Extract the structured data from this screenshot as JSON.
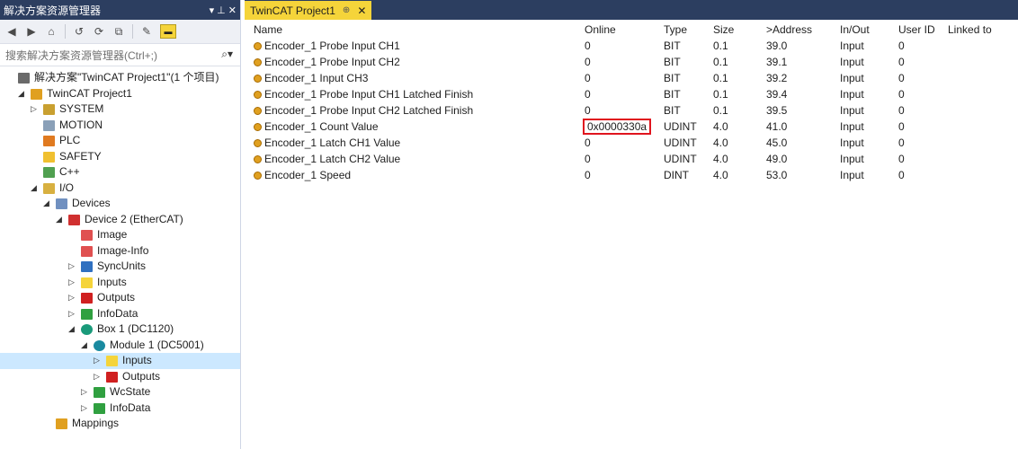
{
  "left_pane": {
    "title": "解决方案资源管理器",
    "pin": "▾ ⊥ ✕",
    "search_placeholder": "搜索解决方案资源管理器(Ctrl+;)",
    "tree": [
      {
        "label": "解决方案\"TwinCAT Project1\"(1 个项目)",
        "level": 0,
        "icon": "solution-icon",
        "toggle": ""
      },
      {
        "label": "TwinCAT Project1",
        "level": 1,
        "icon": "project-icon",
        "toggle": "◢"
      },
      {
        "label": "SYSTEM",
        "level": 2,
        "icon": "system-icon",
        "toggle": "▷"
      },
      {
        "label": "MOTION",
        "level": 2,
        "icon": "motion-icon",
        "toggle": ""
      },
      {
        "label": "PLC",
        "level": 2,
        "icon": "plc-icon",
        "toggle": ""
      },
      {
        "label": "SAFETY",
        "level": 2,
        "icon": "safety-icon",
        "toggle": ""
      },
      {
        "label": "C++",
        "level": 2,
        "icon": "cpp-icon",
        "toggle": ""
      },
      {
        "label": "I/O",
        "level": 2,
        "icon": "io-icon",
        "toggle": "◢"
      },
      {
        "label": "Devices",
        "level": 3,
        "icon": "devices-icon",
        "toggle": "◢"
      },
      {
        "label": "Device 2 (EtherCAT)",
        "level": 4,
        "icon": "ethercat-icon",
        "toggle": "◢"
      },
      {
        "label": "Image",
        "level": 5,
        "icon": "image-icon",
        "toggle": ""
      },
      {
        "label": "Image-Info",
        "level": 5,
        "icon": "image-info-icon",
        "toggle": ""
      },
      {
        "label": "SyncUnits",
        "level": 5,
        "icon": "syncunits-icon",
        "toggle": "▷"
      },
      {
        "label": "Inputs",
        "level": 5,
        "icon": "inputs-icon",
        "toggle": "▷"
      },
      {
        "label": "Outputs",
        "level": 5,
        "icon": "outputs-icon",
        "toggle": "▷"
      },
      {
        "label": "InfoData",
        "level": 5,
        "icon": "infodata-icon",
        "toggle": "▷"
      },
      {
        "label": "Box 1 (DC1120)",
        "level": 5,
        "icon": "box-icon",
        "toggle": "◢"
      },
      {
        "label": "Module 1 (DC5001)",
        "level": 6,
        "icon": "module-icon",
        "toggle": "◢"
      },
      {
        "label": "Inputs",
        "level": 7,
        "icon": "inputs-icon",
        "toggle": "▷",
        "selected": true
      },
      {
        "label": "Outputs",
        "level": 7,
        "icon": "outputs-icon",
        "toggle": "▷"
      },
      {
        "label": "WcState",
        "level": 6,
        "icon": "wcstate-icon",
        "toggle": "▷"
      },
      {
        "label": "InfoData",
        "level": 6,
        "icon": "infodata-icon",
        "toggle": "▷"
      },
      {
        "label": "Mappings",
        "level": 3,
        "icon": "mappings-icon",
        "toggle": ""
      }
    ]
  },
  "tab": {
    "label": "TwinCAT Project1",
    "pin": "⊕",
    "close": "✕"
  },
  "table": {
    "headers": {
      "name": "Name",
      "online": "Online",
      "type": "Type",
      "size": "Size",
      "address": ">Address",
      "inout": "In/Out",
      "userid": "User ID",
      "linked": "Linked to"
    },
    "rows": [
      {
        "name": "Encoder_1 Probe Input CH1",
        "online": "0",
        "type": "BIT",
        "size": "0.1",
        "address": "39.0",
        "inout": "Input",
        "userid": "0"
      },
      {
        "name": "Encoder_1 Probe Input CH2",
        "online": "0",
        "type": "BIT",
        "size": "0.1",
        "address": "39.1",
        "inout": "Input",
        "userid": "0"
      },
      {
        "name": "Encoder_1 Input CH3",
        "online": "0",
        "type": "BIT",
        "size": "0.1",
        "address": "39.2",
        "inout": "Input",
        "userid": "0"
      },
      {
        "name": "Encoder_1 Probe Input CH1 Latched Finish",
        "online": "0",
        "type": "BIT",
        "size": "0.1",
        "address": "39.4",
        "inout": "Input",
        "userid": "0"
      },
      {
        "name": "Encoder_1 Probe Input CH2 Latched Finish",
        "online": "0",
        "type": "BIT",
        "size": "0.1",
        "address": "39.5",
        "inout": "Input",
        "userid": "0"
      },
      {
        "name": "Encoder_1 Count Value",
        "online": "0x0000330a",
        "type": "UDINT",
        "size": "4.0",
        "address": "41.0",
        "inout": "Input",
        "userid": "0",
        "highlight": true
      },
      {
        "name": "Encoder_1 Latch CH1 Value",
        "online": "0",
        "type": "UDINT",
        "size": "4.0",
        "address": "45.0",
        "inout": "Input",
        "userid": "0"
      },
      {
        "name": "Encoder_1 Latch CH2 Value",
        "online": "0",
        "type": "UDINT",
        "size": "4.0",
        "address": "49.0",
        "inout": "Input",
        "userid": "0"
      },
      {
        "name": "Encoder_1 Speed",
        "online": "0",
        "type": "DINT",
        "size": "4.0",
        "address": "53.0",
        "inout": "Input",
        "userid": "0"
      }
    ]
  },
  "colors": {
    "title_bar": "#2c3e60",
    "tab_active": "#f5d43a",
    "selection": "#cce8ff",
    "highlight_border": "#e0141e"
  }
}
